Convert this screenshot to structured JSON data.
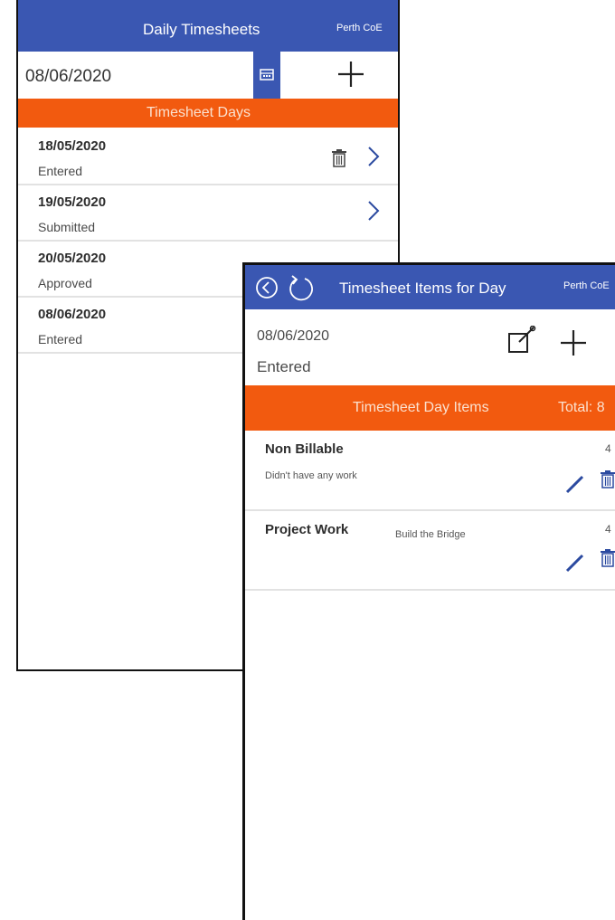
{
  "screen1": {
    "title": "Daily Timesheets",
    "org": "Perth CoE",
    "date_value": "08/06/2020",
    "section_title": "Timesheet Days",
    "days": [
      {
        "date": "18/05/2020",
        "status": "Entered"
      },
      {
        "date": "19/05/2020",
        "status": "Submitted"
      },
      {
        "date": "20/05/2020",
        "status": "Approved"
      },
      {
        "date": "08/06/2020",
        "status": "Entered"
      }
    ]
  },
  "screen2": {
    "title": "Timesheet Items for Day",
    "org": "Perth CoE",
    "date": "08/06/2020",
    "status": "Entered",
    "section_title": "Timesheet Day Items",
    "total_label": "Total: 8",
    "items": [
      {
        "name": "Non Billable",
        "note": "Didn't have any work",
        "hours": "4"
      },
      {
        "name": "Project Work",
        "note": "Build the Bridge",
        "hours": "4"
      }
    ]
  },
  "colors": {
    "header": "#3a57b2",
    "accent": "#f25a0f"
  }
}
